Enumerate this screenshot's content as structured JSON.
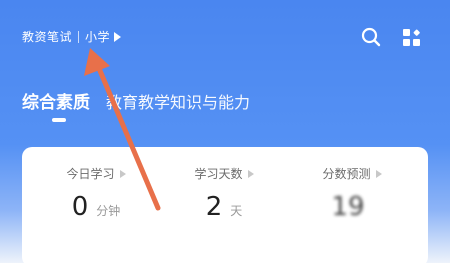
{
  "header": {
    "category": "教资笔试",
    "level": "小学",
    "icons": {
      "search": "search-icon",
      "apps": "grid-icon"
    }
  },
  "tabs": [
    {
      "label": "综合素质",
      "active": true
    },
    {
      "label": "教育教学知识与能力",
      "active": false
    }
  ],
  "stats": [
    {
      "label": "今日学习",
      "value": "0",
      "unit": "分钟"
    },
    {
      "label": "学习天数",
      "value": "2",
      "unit": "天"
    },
    {
      "label": "分数预测",
      "value": "19",
      "unit": ""
    }
  ],
  "colors": {
    "primary": "#4a86f0",
    "arrow": "#e8704a"
  }
}
